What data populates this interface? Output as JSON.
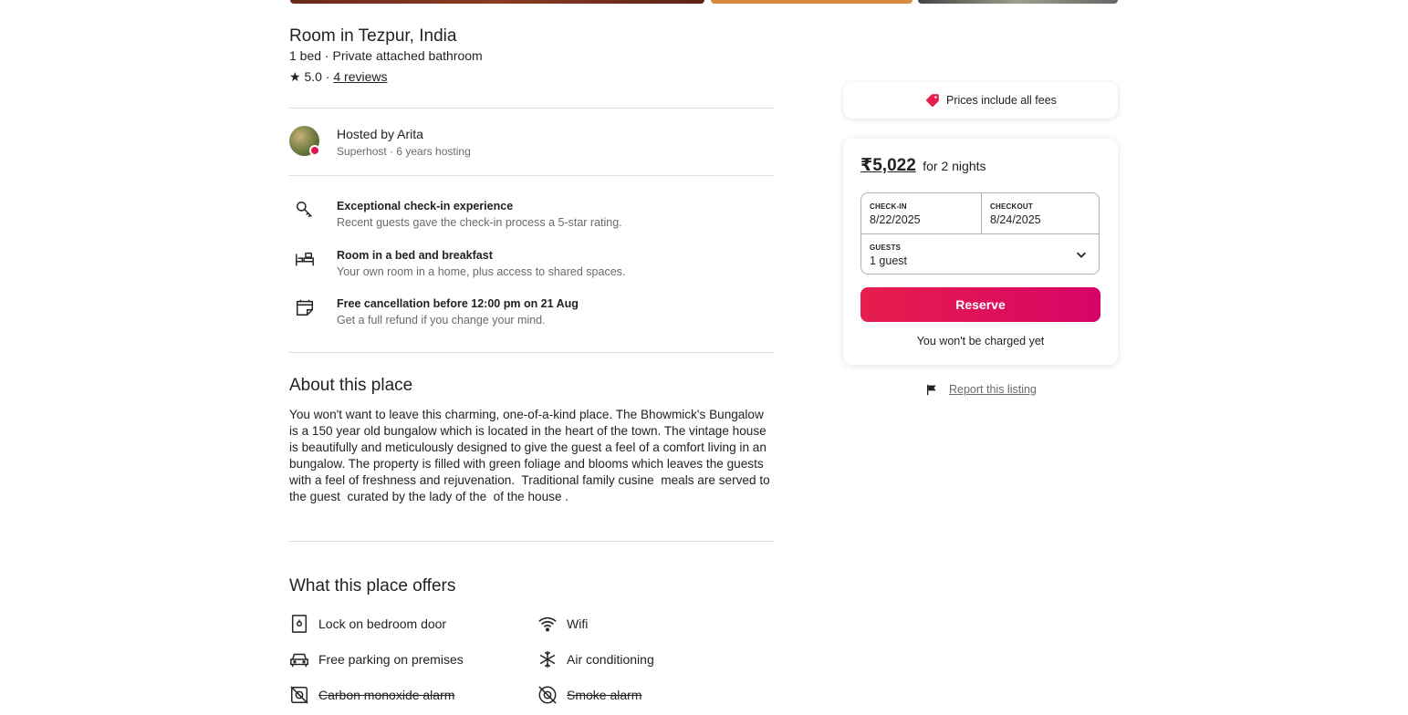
{
  "listing": {
    "title": "Room in Tezpur, India",
    "subtitle": "1 bed · Private attached bathroom",
    "rating": "★ 5.0 ·",
    "reviews_link": "4 reviews"
  },
  "host": {
    "name": "Hosted by Arita",
    "meta": "Superhost · 6 years hosting"
  },
  "highlights": [
    {
      "icon": "key-icon",
      "title": "Exceptional check-in experience",
      "desc": "Recent guests gave the check-in process a 5-star rating."
    },
    {
      "icon": "bed-icon",
      "title": "Room in a bed and breakfast",
      "desc": "Your own room in a home, plus access to shared spaces."
    },
    {
      "icon": "calendar-icon",
      "title": "Free cancellation before 12:00 pm on 21 Aug",
      "desc": "Get a full refund if you change your mind."
    }
  ],
  "about": {
    "heading": "About this place",
    "text": "You won't want to leave this charming, one-of-a-kind place. The Bhowmick's Bungalow is a 150 year old bungalow which is located in the heart of the town. The vintage house is beautifully and meticulously designed to give the guest a feel of a comfort living in an bungalow. The property is filled with green foliage and blooms which leaves the guests with a feel of freshness and rejuvenation.  Traditional family cusine  meals are served to the guest  curated by the lady of the  of the house ."
  },
  "offers": {
    "heading": "What this place offers",
    "items": [
      {
        "icon": "lock-icon",
        "label": "Lock on bedroom door",
        "unavailable": false
      },
      {
        "icon": "wifi-icon",
        "label": "Wifi",
        "unavailable": false
      },
      {
        "icon": "car-icon",
        "label": "Free parking on premises",
        "unavailable": false
      },
      {
        "icon": "snowflake-icon",
        "label": "Air conditioning",
        "unavailable": false
      },
      {
        "icon": "co-alarm-icon",
        "label": "Carbon monoxide alarm",
        "unavailable": true
      },
      {
        "icon": "smoke-alarm-icon",
        "label": "Smoke alarm",
        "unavailable": true
      }
    ]
  },
  "fees_banner": {
    "icon": "price-tag-icon",
    "label": "Prices include all fees"
  },
  "booking": {
    "price": "₹5,022",
    "price_suffix": "for 2 nights",
    "checkin_label": "CHECK-IN",
    "checkin_value": "8/22/2025",
    "checkout_label": "CHECKOUT",
    "checkout_value": "8/24/2025",
    "guests_label": "GUESTS",
    "guests_value": "1 guest",
    "reserve_label": "Reserve",
    "charge_note": "You won't be charged yet"
  },
  "report": {
    "label": "Report this listing"
  },
  "colors": {
    "accent": "#e61e4d",
    "accent_end": "#d70466",
    "text": "#222222",
    "muted": "#6a6a6a",
    "divider": "#dddddd"
  }
}
